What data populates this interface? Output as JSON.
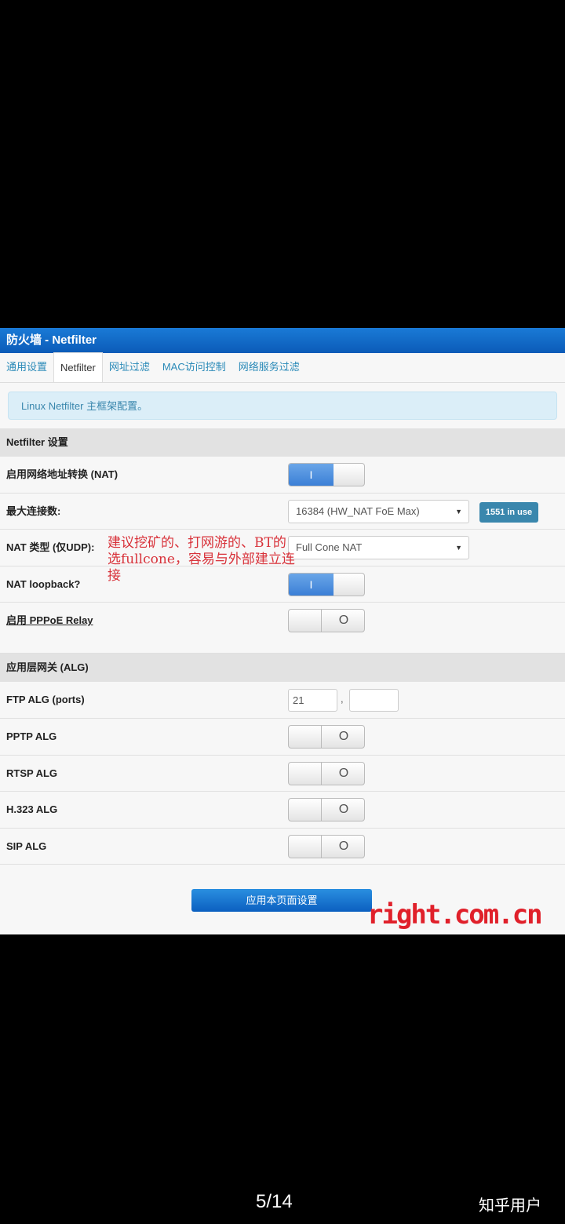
{
  "header": {
    "title": "防火墙 - Netfilter"
  },
  "tabs": [
    "通用设置",
    "Netfilter",
    "网址过滤",
    "MAC访问控制",
    "网络服务过滤"
  ],
  "alert": "Linux Netfilter 主框架配置。",
  "section1": {
    "title": "Netfilter 设置",
    "nat_label": "启用网络地址转换 (NAT)",
    "maxconn_label": "最大连接数:",
    "maxconn_value": "16384 (HW_NAT FoE Max)",
    "maxconn_badge": "1551 in use",
    "nattype_label": "NAT 类型 (仅UDP):",
    "nattype_value": "Full Cone NAT",
    "loopback_label": "NAT loopback?",
    "pppoe_label": "启用 PPPoE Relay"
  },
  "section2": {
    "title": "应用层网关 (ALG)",
    "ftp_label": "FTP ALG (ports)",
    "ftp_port1": "21",
    "ftp_sep": ",",
    "pptp_label": "PPTP ALG",
    "rtsp_label": "RTSP ALG",
    "h323_label": "H.323 ALG",
    "sip_label": "SIP ALG"
  },
  "toggle": {
    "on": "I",
    "off": "O"
  },
  "arrow": "▼",
  "apply_label": "应用本页面设置",
  "annotation": "建议挖矿的、打网游的、BT的选fullcone，容易与外部建立连接",
  "watermark": "right.com.cn",
  "pager": "5/14",
  "author": "知乎用户"
}
